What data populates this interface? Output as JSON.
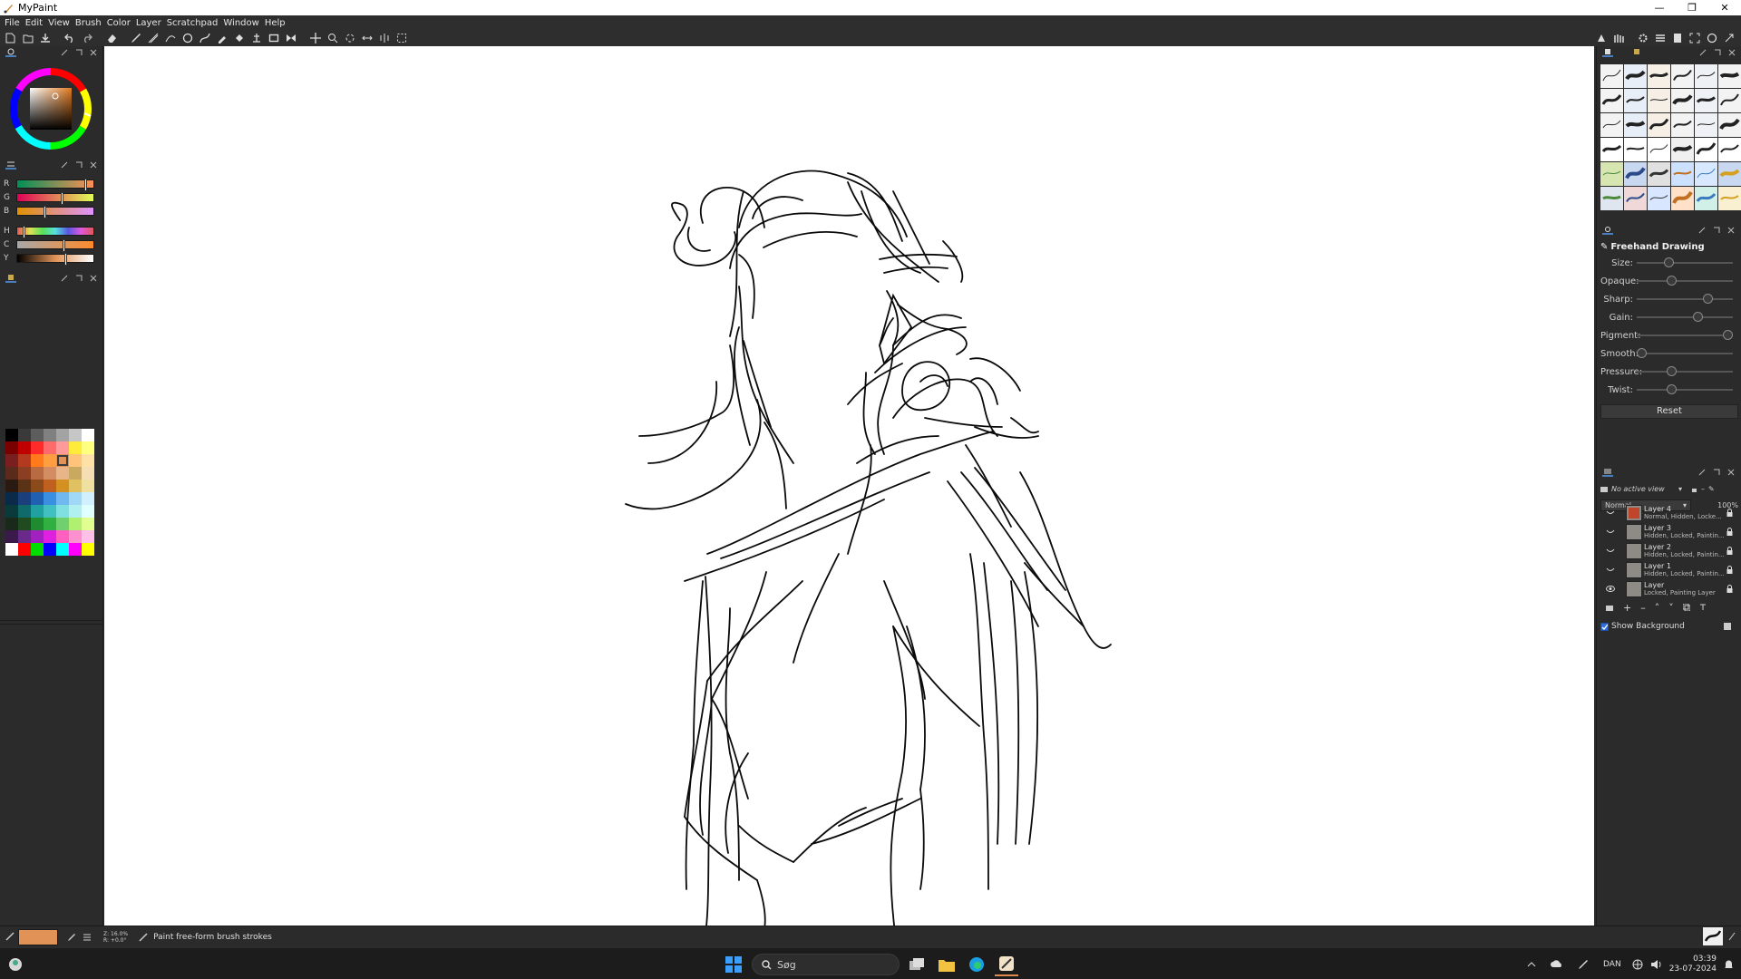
{
  "window": {
    "title": "MyPaint"
  },
  "menu": {
    "items": [
      "File",
      "Edit",
      "View",
      "Brush",
      "Color",
      "Layer",
      "Scratchpad",
      "Window",
      "Help"
    ]
  },
  "colors": {
    "current_color": "#e09257",
    "accent": "#4a7fbf"
  },
  "sliders": {
    "labels": [
      "R",
      "G",
      "B",
      "H",
      "C",
      "Y"
    ]
  },
  "brush_settings": {
    "title": "Freehand Drawing",
    "rows": [
      {
        "label": "Size:",
        "value": 0.32
      },
      {
        "label": "Opaque:",
        "value": 0.35
      },
      {
        "label": "Sharp:",
        "value": 0.77
      },
      {
        "label": "Gain:",
        "value": 0.65
      },
      {
        "label": "Pigment:",
        "value": 1.0
      },
      {
        "label": "Smooth:",
        "value": 0.0
      },
      {
        "label": "Pressure:",
        "value": 0.35
      },
      {
        "label": "Twist:",
        "value": 0.35
      }
    ],
    "reset_label": "Reset"
  },
  "layers_panel": {
    "view_selector": "No active view",
    "blend_mode": "Normal",
    "opacity": "100%",
    "layers": [
      {
        "name": "Layer 4",
        "status": "Normal, Hidden, Locke..."
      },
      {
        "name": "Layer 3",
        "status": "Hidden, Locked, Paintin..."
      },
      {
        "name": "Layer 2",
        "status": "Hidden, Locked, Paintin..."
      },
      {
        "name": "Layer 1",
        "status": "Hidden, Locked, Paintin..."
      },
      {
        "name": "Layer",
        "status": "Locked, Painting Layer"
      }
    ],
    "show_background_label": "Show Background"
  },
  "statusbar": {
    "zoom_line1": "Z: 16.0%",
    "zoom_line2": "R: +0.0°",
    "message": "Paint free-form brush strokes"
  },
  "taskbar": {
    "search_placeholder": "Søg",
    "language": "DAN",
    "time": "03:39",
    "date": "23-07-2024"
  }
}
